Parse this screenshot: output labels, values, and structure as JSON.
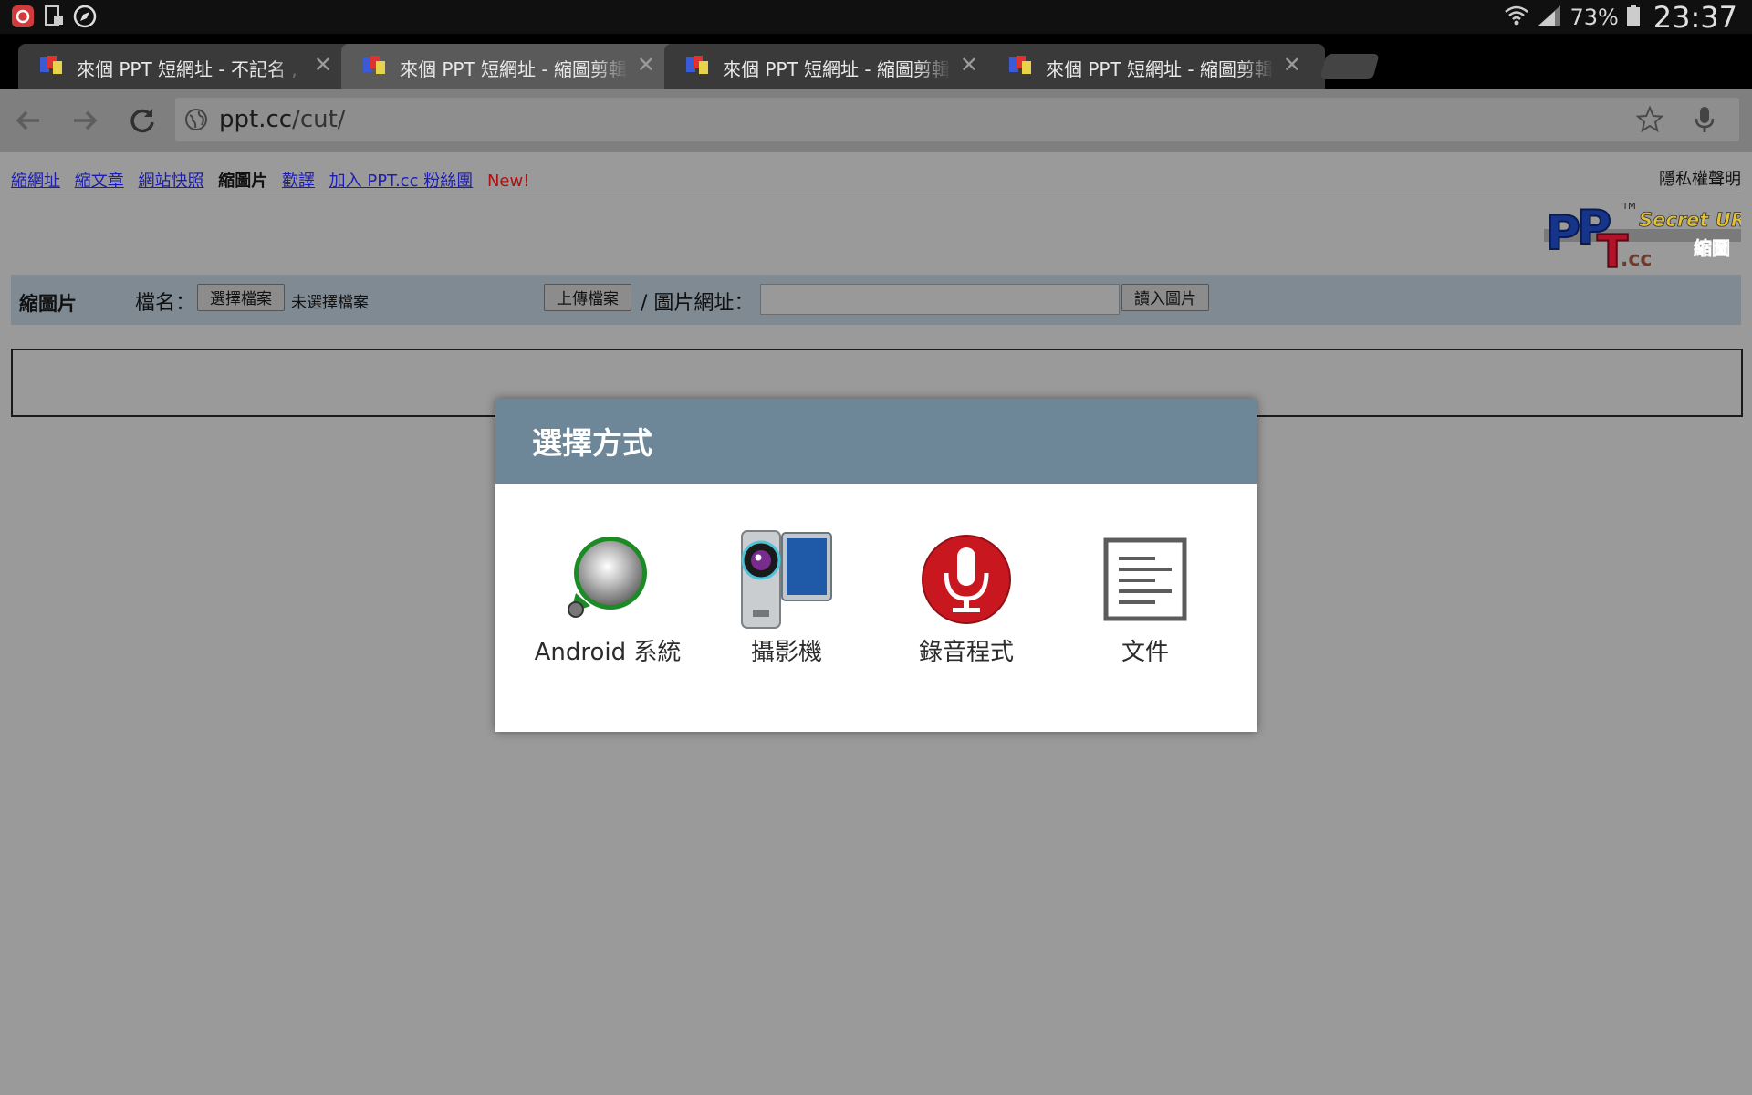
{
  "status_bar": {
    "battery": "73%",
    "time": "23:37"
  },
  "tabs": [
    {
      "title": "來個 PPT 短網址 - 不記名 ,",
      "active": false
    },
    {
      "title": "來個 PPT 短網址 - 縮圖剪輯",
      "active": true
    },
    {
      "title": "來個 PPT 短網址 - 縮圖剪輯",
      "active": false
    },
    {
      "title": "來個 PPT 短網址 - 縮圖剪輯",
      "active": false
    }
  ],
  "address_bar": {
    "host": "ppt.cc",
    "path": "/cut/"
  },
  "page": {
    "nav": [
      "縮網址",
      "縮文章",
      "網站快照",
      "縮圖片",
      "歡譯",
      "加入 PPT.cc 粉絲團"
    ],
    "nav_new": "New!",
    "privacy": "隱私權聲明",
    "logo_alt": "PPT.cc Secret URL 縮圖",
    "form": {
      "section_title": "縮圖片",
      "filename_label": "檔名：",
      "choose_file": "選擇檔案",
      "no_file": "未選擇檔案",
      "upload": "上傳檔案",
      "url_label": "/ 圖片網址：",
      "url_value": "",
      "load": "讀入圖片"
    }
  },
  "dialog": {
    "title": "選擇方式",
    "options": [
      {
        "label": "Android 系統",
        "icon": "android-system-icon"
      },
      {
        "label": "攝影機",
        "icon": "camcorder-icon"
      },
      {
        "label": "錄音程式",
        "icon": "voice-recorder-icon"
      },
      {
        "label": "文件",
        "icon": "document-icon"
      }
    ]
  },
  "colors": {
    "dialog_header": "#6d8799",
    "form_bar": "#7f8a93",
    "link": "#1d1daf",
    "new_badge": "#b01010"
  }
}
